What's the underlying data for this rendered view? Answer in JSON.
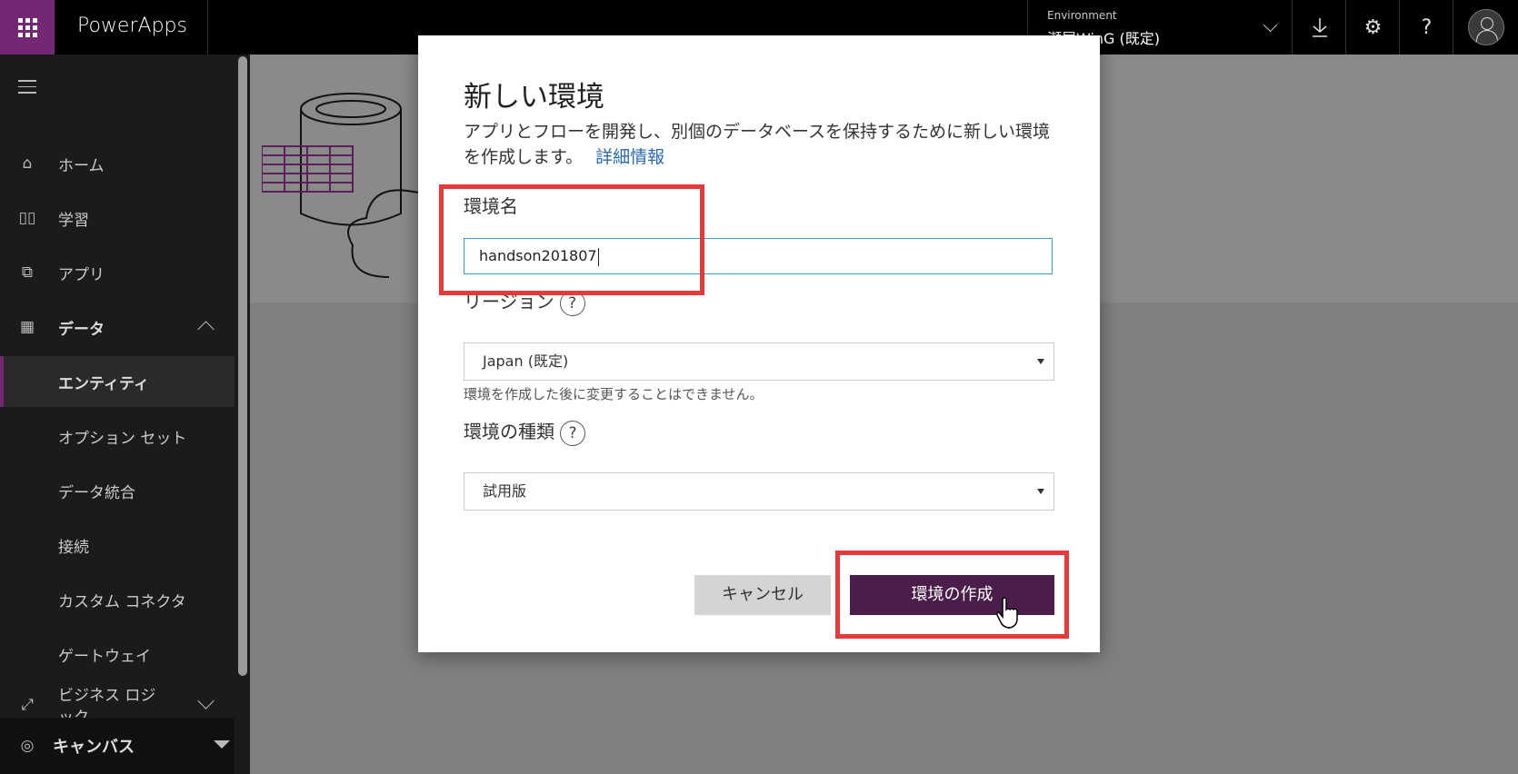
{
  "header": {
    "brand": "PowerApps",
    "environment_label": "Environment",
    "environment_value": "瀬尾WinG (既定)"
  },
  "sidebar": {
    "items": [
      {
        "label": "ホーム",
        "icon": "home-icon"
      },
      {
        "label": "学習",
        "icon": "book-icon"
      },
      {
        "label": "アプリ",
        "icon": "apps-icon"
      },
      {
        "label": "データ",
        "icon": "table-icon"
      },
      {
        "label": "エンティティ"
      },
      {
        "label": "オプション セット"
      },
      {
        "label": "データ統合"
      },
      {
        "label": "接続"
      },
      {
        "label": "カスタム コネクタ"
      },
      {
        "label": "ゲートウェイ"
      },
      {
        "label": "ビジネス ロジック",
        "icon": "flow-icon"
      },
      {
        "label": "キャンバス",
        "icon": "gauge-icon"
      }
    ]
  },
  "dialog": {
    "title": "新しい環境",
    "description": "アプリとフローを開発し、別個のデータベースを保持するために新しい環境を作成します。",
    "learn_more": "詳細情報",
    "name_label": "環境名",
    "name_value": "handson201807",
    "region_label": "リージョン",
    "region_value": "Japan (既定)",
    "region_hint": "環境を作成した後に変更することはできません。",
    "type_label": "環境の種類",
    "type_value": "試用版",
    "cancel_label": "キャンセル",
    "create_label": "環境の作成"
  },
  "colors": {
    "brand_purple": "#742774",
    "create_button": "#4a1d4a",
    "highlight": "#e53a3a",
    "link": "#2a6ab0"
  }
}
